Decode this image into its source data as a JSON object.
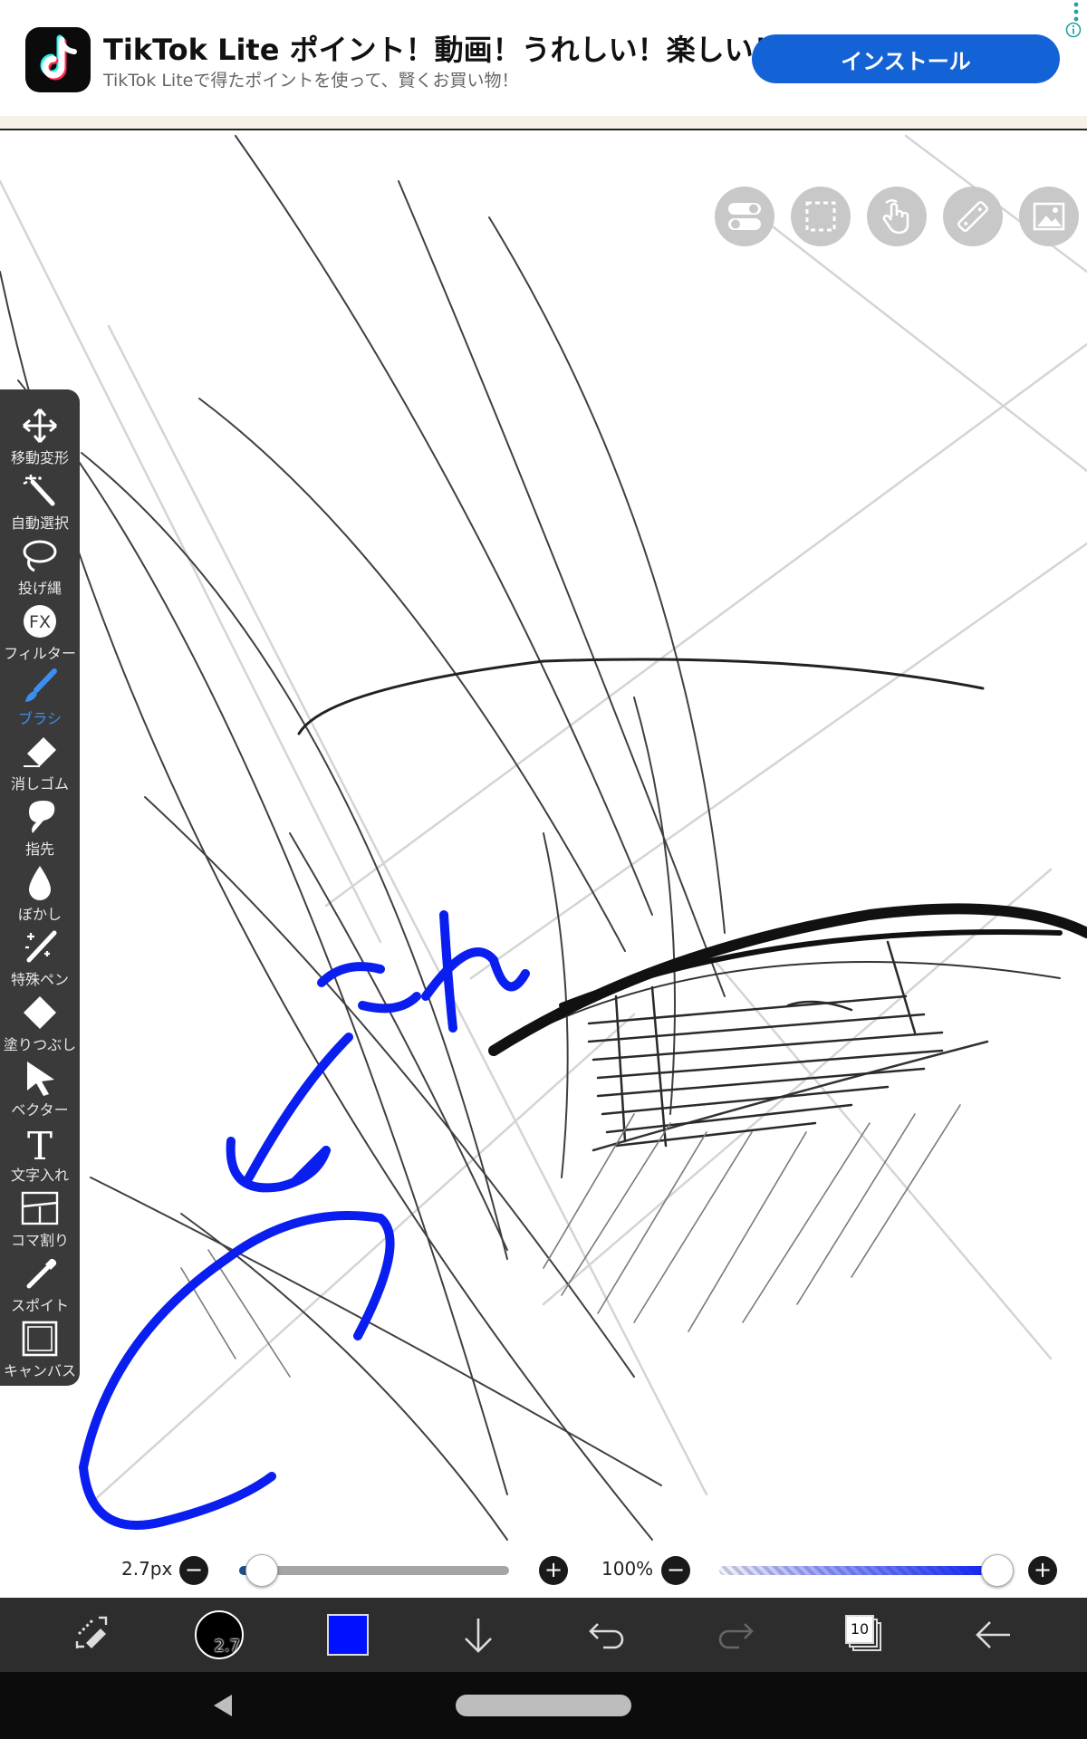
{
  "ad": {
    "title": "TikTok Lite ポイント！動画！うれしい！楽しい！",
    "subtitle": "TikTok Liteで得たポイントを使って、賢くお買い物！",
    "install_label": "インストール",
    "icon": "tiktok-logo"
  },
  "canvas": {
    "annotation_text": "これ",
    "annotation_color": "#0a1ef0",
    "top_buttons": [
      "toggle-icon",
      "selection-icon",
      "hand-icon",
      "ruler-icon",
      "image-icon"
    ]
  },
  "tools": [
    {
      "label": "移動変形",
      "icon": "move-icon"
    },
    {
      "label": "自動選択",
      "icon": "magic-wand-icon"
    },
    {
      "label": "投げ縄",
      "icon": "lasso-icon"
    },
    {
      "label": "フィルター",
      "icon": "fx-icon"
    },
    {
      "label": "ブラシ",
      "icon": "brush-icon",
      "active": true
    },
    {
      "label": "消しゴム",
      "icon": "eraser-icon"
    },
    {
      "label": "指先",
      "icon": "finger-icon"
    },
    {
      "label": "ぼかし",
      "icon": "blur-drop-icon"
    },
    {
      "label": "特殊ペン",
      "icon": "special-pen-icon"
    },
    {
      "label": "塗りつぶし",
      "icon": "fill-icon"
    },
    {
      "label": "ベクター",
      "icon": "vector-cursor-icon"
    },
    {
      "label": "文字入れ",
      "icon": "text-icon"
    },
    {
      "label": "コマ割り",
      "icon": "panel-icon"
    },
    {
      "label": "スポイト",
      "icon": "eyedropper-icon"
    },
    {
      "label": "キャンバス",
      "icon": "canvas-icon"
    }
  ],
  "brush": {
    "size_label": "2.7px",
    "size_fraction": 0.08,
    "opacity_label": "100%",
    "opacity_fraction": 1.0
  },
  "toolbar": {
    "brush_size_badge": "2.7",
    "color_swatch": "#0011ff",
    "layer_count": "10"
  },
  "colors": {
    "toolbar_bg": "#2d2d2d",
    "accent": "#3d8ef0",
    "install_blue": "#1463d6"
  }
}
